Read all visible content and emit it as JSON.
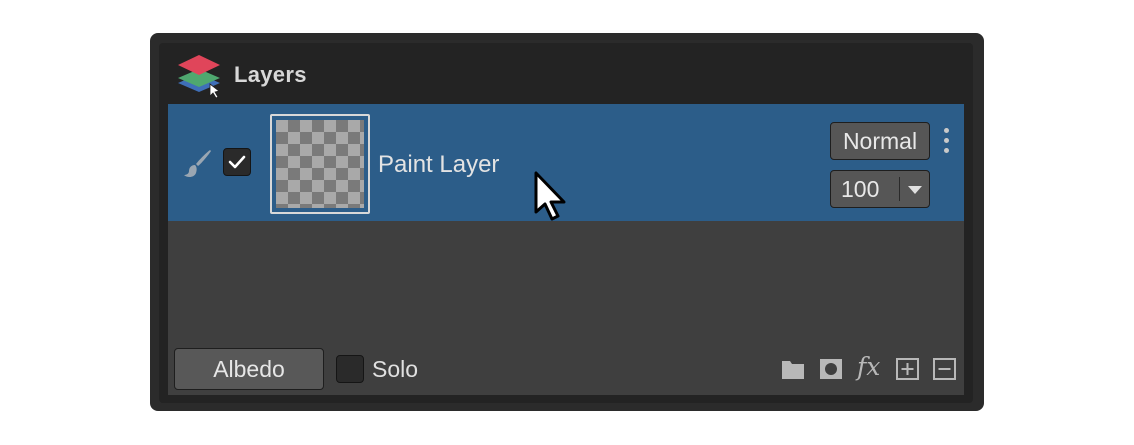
{
  "panel": {
    "title": "Layers",
    "logo_icon": "layers-stack-icon"
  },
  "layer": {
    "name": "Paint Layer",
    "visible": true,
    "selected": true,
    "brush_icon": "paint-brush-icon",
    "blend_mode": "Normal",
    "opacity": "100",
    "row_color": "#2c5d89"
  },
  "footer": {
    "channel_button": "Albedo",
    "solo_label": "Solo",
    "solo_checked": false,
    "tools": [
      "folder-icon",
      "mask-icon",
      "fx-icon",
      "add-layer-icon",
      "remove-layer-icon"
    ],
    "fx_label": "fx"
  }
}
